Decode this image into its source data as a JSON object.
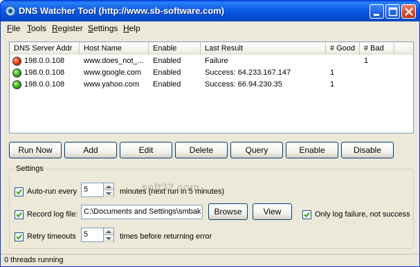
{
  "window": {
    "title": "DNS Watcher Tool (http://www.sb-software.com)"
  },
  "menu": [
    {
      "label": "File",
      "underline": "F",
      "rest": "ile"
    },
    {
      "label": "Tools",
      "underline": "T",
      "rest": "ools"
    },
    {
      "label": "Register",
      "underline": "R",
      "rest": "egister"
    },
    {
      "label": "Settings",
      "underline": "S",
      "rest": "ettings"
    },
    {
      "label": "Help",
      "underline": "H",
      "rest": "elp"
    }
  ],
  "table": {
    "columns": [
      "DNS Server Addr",
      "Host Name",
      "Enable",
      "Last Result",
      "# Good",
      "# Bad"
    ],
    "rows": [
      {
        "status": "red",
        "server": "198.0.0.108",
        "host": "www.does_not_...",
        "enable": "Enabled",
        "result": "Failure",
        "good": "",
        "bad": "1"
      },
      {
        "status": "green",
        "server": "198.0.0.108",
        "host": "www.google.com",
        "enable": "Enabled",
        "result": "Success: 64.233.167.147",
        "good": "1",
        "bad": ""
      },
      {
        "status": "green",
        "server": "198.0.0.108",
        "host": "www.yahoo.com",
        "enable": "Enabled",
        "result": "Success: 66.94.230.35",
        "good": "1",
        "bad": ""
      }
    ]
  },
  "buttons": {
    "run_now": "Run Now",
    "add": "Add",
    "edit": "Edit",
    "delete": "Delete",
    "query": "Query",
    "enable": "Enable",
    "disable": "Disable"
  },
  "settings": {
    "group_label": "Settings",
    "autorun_label": "Auto-run every",
    "autorun_value": "5",
    "autorun_suffix": "minutes (next run in 5 minutes)",
    "autorun_checked": true,
    "record_label": "Record log file:",
    "record_path": "C:\\Documents and Settings\\smbak",
    "record_checked": true,
    "browse_label": "Browse",
    "view_label": "View",
    "only_failure_label": "Only log failure, not success",
    "only_failure_checked": true,
    "retry_label": "Retry timeouts",
    "retry_value": "5",
    "retry_suffix": "times before returning error",
    "retry_checked": true
  },
  "status": {
    "text": "0 threads running"
  },
  "watermark": "soft32.com"
}
